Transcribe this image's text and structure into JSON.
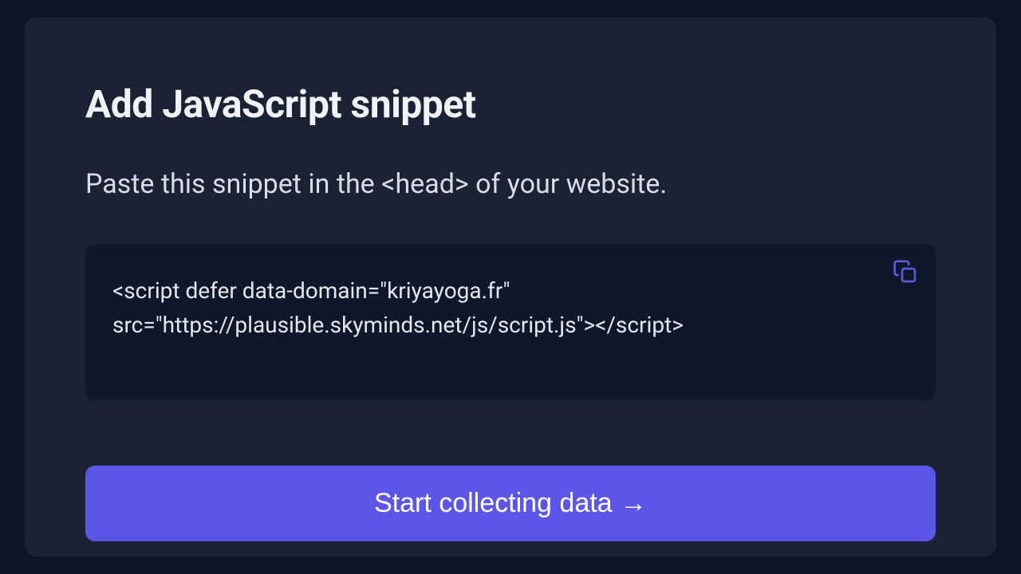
{
  "heading": "Add JavaScript snippet",
  "description": {
    "before": "Paste this snippet in the ",
    "code": "<head>",
    "after": " of your website."
  },
  "snippet": "<script defer data-domain=\"kriyayoga.fr\" src=\"https://plausible.skyminds.net/js/script.js\"></script>",
  "button": {
    "label": "Start collecting data →"
  },
  "icons": {
    "copy": "copy-icon"
  }
}
